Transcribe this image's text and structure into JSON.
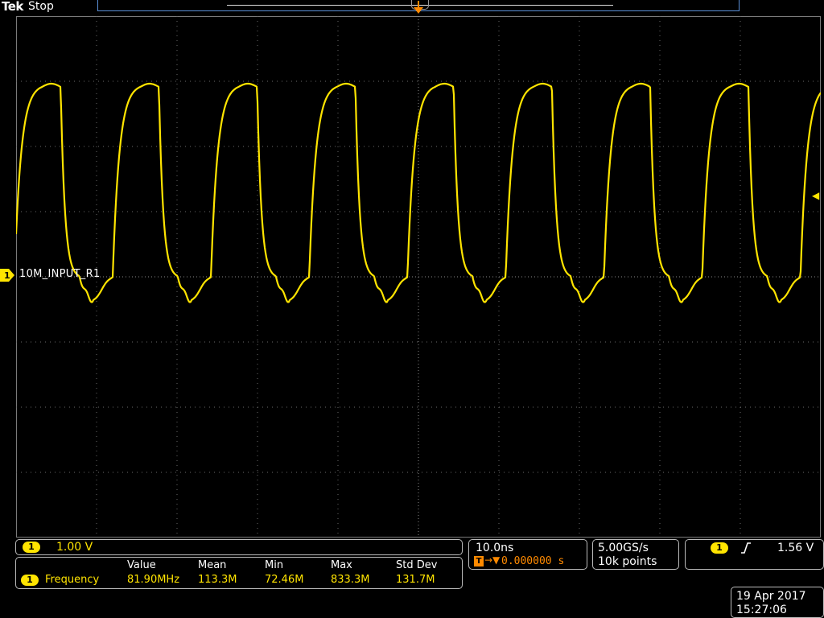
{
  "header": {
    "brand": "Tek",
    "run_state": "Stop"
  },
  "trigger_marker_label": "T",
  "channel": {
    "number": "1",
    "label": "10M_INPUT_R1",
    "scale": "1.00 V",
    "color": "#ffe400"
  },
  "measurement": {
    "headers": [
      "Value",
      "Mean",
      "Min",
      "Max",
      "Std Dev"
    ],
    "name": "Frequency",
    "values": [
      "81.90MHz",
      "113.3M",
      "72.46M",
      "833.3M",
      "131.7M"
    ]
  },
  "horizontal": {
    "scale": "10.0ns",
    "position": "0.000000 s"
  },
  "acquisition": {
    "sample_rate": "5.00GS/s",
    "record_length": "10k points"
  },
  "trigger": {
    "source": "1",
    "slope_icon": "rising-edge-icon",
    "level": "1.56 V"
  },
  "datetime": {
    "date": "19 Apr 2017",
    "time": "15:27:06"
  },
  "colors": {
    "trigger": "#ff8a00",
    "graticule": "#7a7a7a",
    "record_view": "#5a8fd6"
  }
}
